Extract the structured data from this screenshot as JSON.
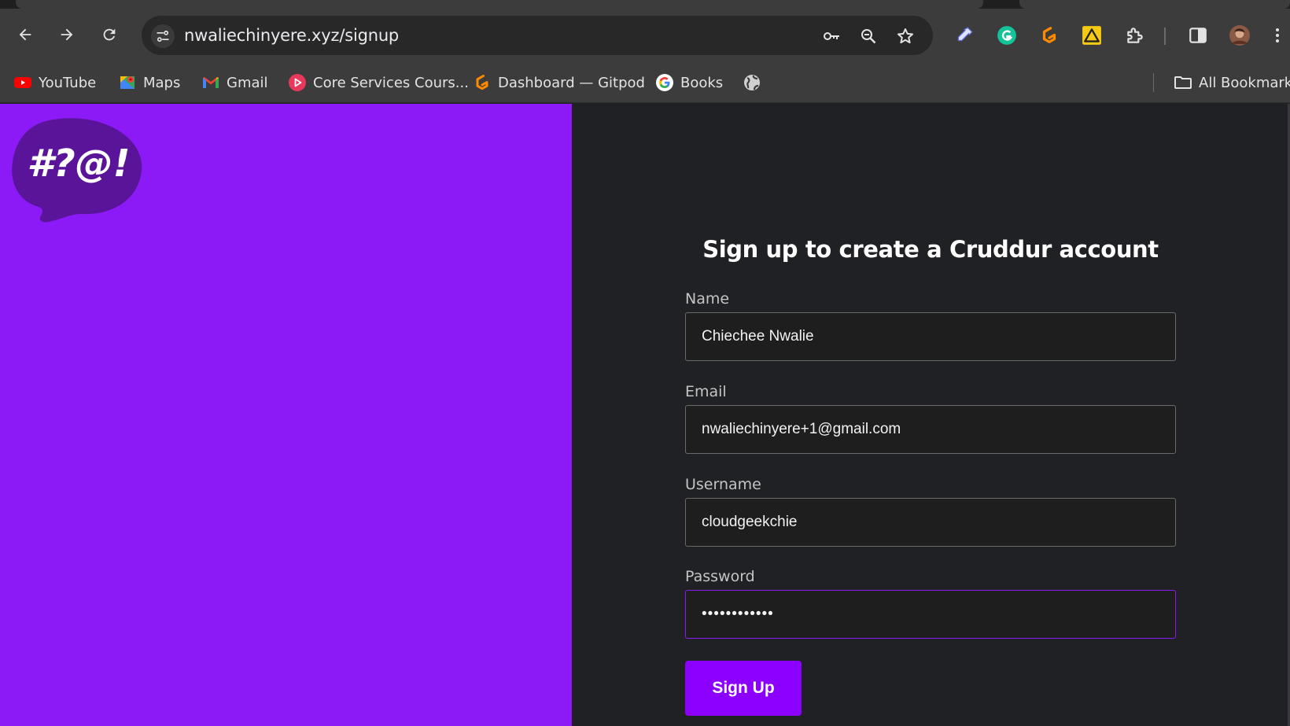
{
  "browser": {
    "url": "nwaliechinyere.xyz/signup",
    "bookmarks": [
      {
        "label": "YouTube",
        "icon": "youtube-icon"
      },
      {
        "label": "Maps",
        "icon": "maps-icon"
      },
      {
        "label": "Gmail",
        "icon": "gmail-icon"
      },
      {
        "label": "Core Services Cours...",
        "icon": "play-circle-icon"
      },
      {
        "label": "Dashboard — Gitpod",
        "icon": "gitpod-icon"
      },
      {
        "label": "Books",
        "icon": "google-icon"
      },
      {
        "label": "",
        "icon": "globe-icon"
      }
    ],
    "all_bookmarks_label": "All Bookmarks"
  },
  "logo": {
    "text": "#?@!"
  },
  "form": {
    "title": "Sign up to create a Cruddur account",
    "name": {
      "label": "Name",
      "value": "Chiechee Nwalie"
    },
    "email": {
      "label": "Email",
      "value": "nwaliechinyere+1@gmail.com"
    },
    "username": {
      "label": "Username",
      "value": "cloudgeekchie"
    },
    "password": {
      "label": "Password",
      "value": "••••••••••••"
    },
    "submit_label": "Sign Up"
  },
  "colors": {
    "brand_purple": "#8c1af6",
    "button_purple": "#8c00ff",
    "page_dark": "#202124",
    "chrome": "#3c3c3c"
  }
}
